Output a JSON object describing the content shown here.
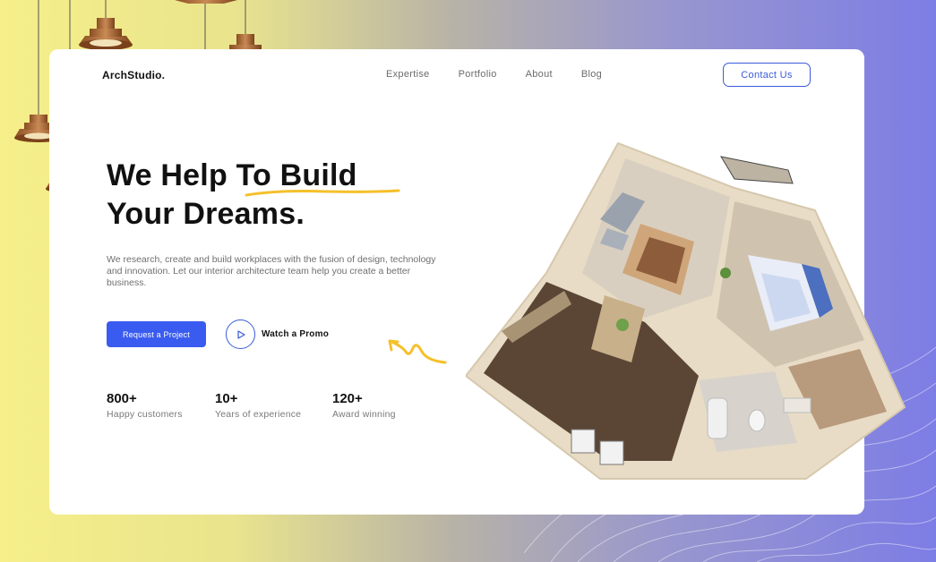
{
  "brand": {
    "logo": "ArchStudio."
  },
  "nav": {
    "items": [
      {
        "label": "Expertise"
      },
      {
        "label": "Portfolio"
      },
      {
        "label": "About"
      },
      {
        "label": "Blog"
      }
    ],
    "contact_label": "Contact Us"
  },
  "hero": {
    "headline_line1_a": "We Help ",
    "headline_line1_b": "To Build",
    "headline_line2": "Your Dreams.",
    "description": "We research, create and build workplaces with the fusion of design, technology and innovation. Let our interior architecture team help you create a better business.",
    "cta_label": "Request a Project",
    "promo_label": "Watch a Promo"
  },
  "stats": [
    {
      "value": "800+",
      "label": "Happy customers"
    },
    {
      "value": "10+",
      "label": "Years of experience"
    },
    {
      "value": "120+",
      "label": "Award winning"
    }
  ],
  "colors": {
    "accent": "#3a5bf0",
    "highlight": "#f5c02a",
    "bg_left": "#f6ef8a",
    "bg_right": "#7d7de6"
  }
}
